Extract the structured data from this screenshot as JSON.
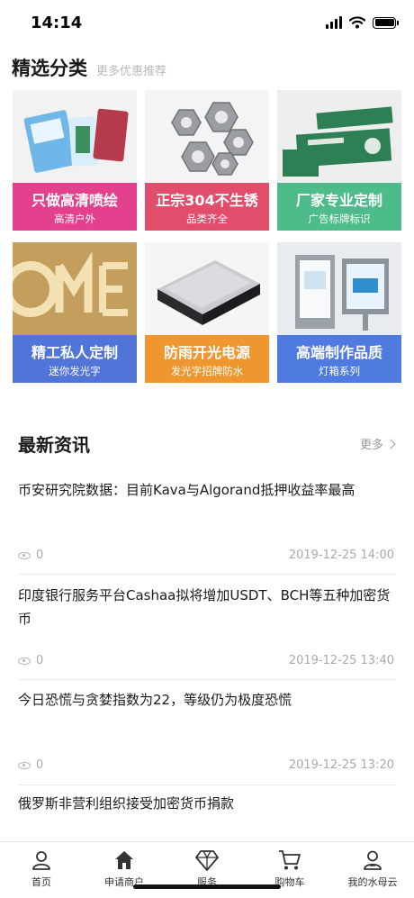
{
  "status": {
    "time": "14:14"
  },
  "section": {
    "title": "精选分类",
    "subtitle": "更多优惠推荐"
  },
  "categories": [
    {
      "title": "只做高清喷绘",
      "sub": "高清户外",
      "color": "#e3418d",
      "icon": "banner-print-image"
    },
    {
      "title": "正宗304不生锈",
      "sub": "品类齐全",
      "color": "#e24d6c",
      "icon": "hex-nut-image"
    },
    {
      "title": "厂家专业定制",
      "sub": "广告标牌标识",
      "color": "#4dbb8a",
      "icon": "sign-plate-image"
    },
    {
      "title": "精工私人定制",
      "sub": "迷你发光字",
      "color": "#5074d8",
      "icon": "gold-letters-image"
    },
    {
      "title": "防雨开光电源",
      "sub": "发光字招牌防水",
      "color": "#f0962f",
      "icon": "power-supply-image"
    },
    {
      "title": "高端制作品质",
      "sub": "灯箱系列",
      "color": "#4f7be0",
      "icon": "lightbox-image"
    }
  ],
  "news": {
    "title": "最新资讯",
    "more": "更多",
    "items": [
      {
        "text": "币安研究院数据：目前Kava与Algorand抵押收益率最高",
        "views": "0",
        "date": "2019-12-25 14:00"
      },
      {
        "text": "印度银行服务平台Cashaa拟将增加USDT、BCH等五种加密货币",
        "views": "0",
        "date": "2019-12-25 13:40"
      },
      {
        "text": "今日恐慌与贪婪指数为22，等级仍为极度恐慌",
        "views": "0",
        "date": "2019-12-25 13:20"
      },
      {
        "text": "俄罗斯非营利组织接受加密货币捐款"
      }
    ]
  },
  "tabs": [
    {
      "label": "首页",
      "icon": "user-icon"
    },
    {
      "label": "申请商户",
      "icon": "home-icon"
    },
    {
      "label": "服务",
      "icon": "diamond-icon"
    },
    {
      "label": "购物车",
      "icon": "cart-icon"
    },
    {
      "label": "我的水母云",
      "icon": "profile-icon"
    }
  ]
}
